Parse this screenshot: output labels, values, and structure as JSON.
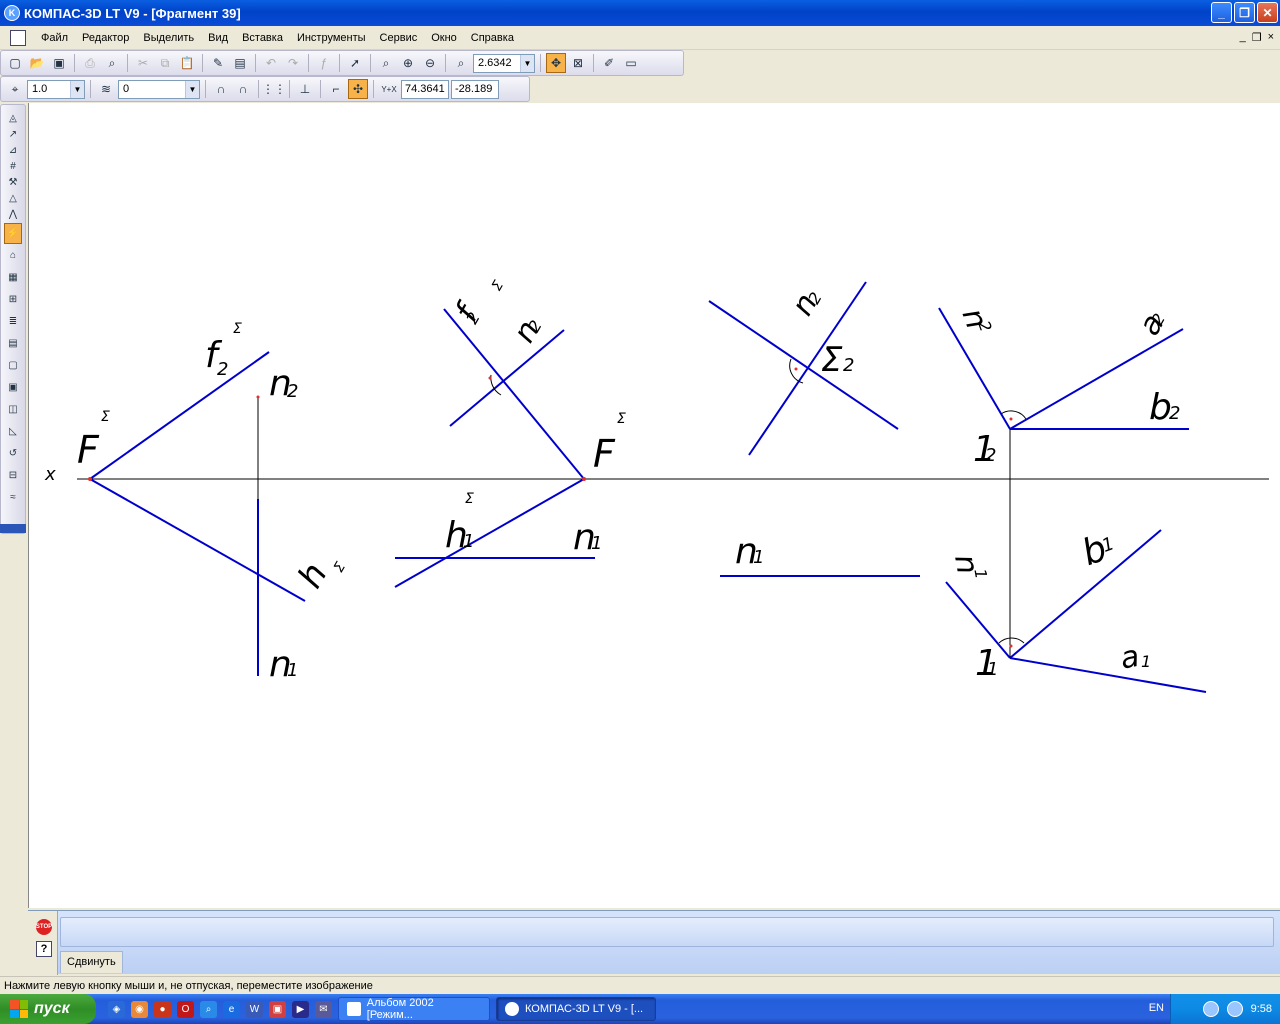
{
  "window": {
    "title": "КОМПАС-3D LT V9 - [Фрагмент 39]",
    "minimize": "_",
    "restore": "❐",
    "close": "✕"
  },
  "menu": {
    "items": [
      {
        "label": "Файл"
      },
      {
        "label": "Редактор"
      },
      {
        "label": "Выделить"
      },
      {
        "label": "Вид"
      },
      {
        "label": "Вставка"
      },
      {
        "label": "Инструменты"
      },
      {
        "label": "Сервис"
      },
      {
        "label": "Окно"
      },
      {
        "label": "Справка"
      }
    ],
    "mdi_minimize": "_",
    "mdi_restore": "❐",
    "mdi_close": "×"
  },
  "toolbar_standard": {
    "zoom_value": "2.6342"
  },
  "toolbar_current_state": {
    "step_value": "1.0",
    "layer_value": "0",
    "coord_x": "74.3641",
    "coord_y": "-28.189",
    "coord_label": "Y+X"
  },
  "drawing": {
    "axis_label": "x",
    "labels": {
      "F_sigma_a": "F",
      "f2_a": "f",
      "n2_a": "n",
      "h1_a": "h",
      "n1_a": "n",
      "f2_b": "f",
      "n2_b": "n",
      "F_sigma_b": "F",
      "h1_b": "h",
      "n1_b": "n",
      "n2_c": "n",
      "sigma2_c": "Σ",
      "n1_c": "n",
      "n2_d": "n",
      "a2_d": "a",
      "b2_d": "b",
      "one2_d": "1",
      "n1_d": "n",
      "b1_d": "b",
      "a1_d": "a",
      "one1_d": "1"
    },
    "subscripts": {
      "two": "2",
      "one": "1",
      "sigma": "Σ"
    },
    "line_color": "#0000CC",
    "axis_color": "#000000",
    "point_color": "#E03030"
  },
  "panel": {
    "tab_label": "Сдвинуть",
    "stop_label": "STOP",
    "help_label": "?"
  },
  "status": {
    "hint": "Нажмите левую кнопку мыши и, не отпуская, переместите изображение"
  },
  "taskbar": {
    "start_label": "пуск",
    "tasks": [
      {
        "label": "Альбом 2002 [Режим..."
      },
      {
        "label": "КОМПАС-3D LT V9 - [..."
      }
    ],
    "lang": "EN",
    "clock": "9:58"
  }
}
